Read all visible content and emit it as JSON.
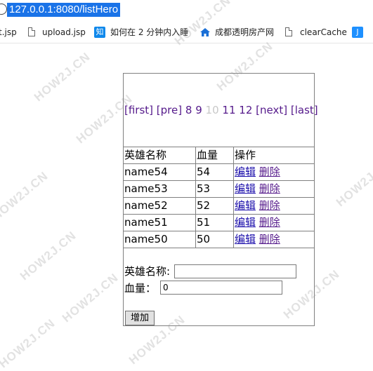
{
  "browser": {
    "url": "127.0.0.1:8080/listHero"
  },
  "bookmarks": [
    {
      "label": "t.jsp",
      "icon": "document-icon"
    },
    {
      "label": "upload.jsp",
      "icon": "document-icon"
    },
    {
      "label": "如何在 2 分钟内入睡",
      "icon": "zhihu-icon"
    },
    {
      "label": "成都透明房产网",
      "icon": "house-icon"
    },
    {
      "label": "clearCache",
      "icon": "document-icon"
    }
  ],
  "pager": {
    "first": "[first]",
    "pre": "[pre]",
    "pages": [
      "8",
      "9",
      "10",
      "11",
      "12"
    ],
    "current": "10",
    "next": "[next]",
    "last": "[last]"
  },
  "table": {
    "headers": [
      "英雄名称",
      "血量",
      "操作"
    ],
    "rows": [
      {
        "name": "name54",
        "hp": "54",
        "edit": "编辑",
        "delete": "删除"
      },
      {
        "name": "name53",
        "hp": "53",
        "edit": "编辑",
        "delete": "删除"
      },
      {
        "name": "name52",
        "hp": "52",
        "edit": "编辑",
        "delete": "删除"
      },
      {
        "name": "name51",
        "hp": "51",
        "edit": "编辑",
        "delete": "删除"
      },
      {
        "name": "name50",
        "hp": "50",
        "edit": "编辑",
        "delete": "删除"
      }
    ]
  },
  "form": {
    "name_label": "英雄名称:",
    "name_value": "",
    "hp_label": "血量：",
    "hp_value": "0",
    "submit_label": "增加"
  },
  "watermark": "HOW2J.CN"
}
